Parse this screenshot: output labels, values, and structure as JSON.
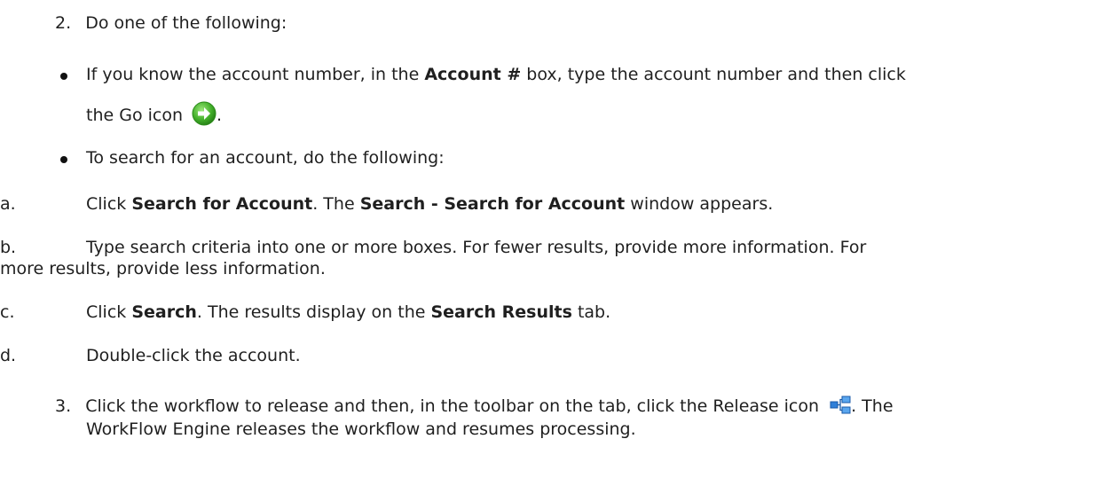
{
  "step2": {
    "number": "2.",
    "text": "Do one of the following:"
  },
  "bullet1": {
    "t1": "If you know the account number, in the ",
    "b1": "Account #",
    "t2": " box, type the account number and then click",
    "t3": "the Go icon ",
    "t4": ".",
    "icon": "go-arrow-icon"
  },
  "bullet2": {
    "text": "To search for an account, do the following:"
  },
  "suba": {
    "label": "a.",
    "t1": "Click ",
    "b1": "Search for Account",
    "t2": ". The ",
    "b2": "Search - Search for Account",
    "t3": " window appears."
  },
  "subb": {
    "label": "b.",
    "t1": "Type search criteria into one or more boxes. For fewer results, provide more information. For",
    "t2": "more results, provide less information."
  },
  "subc": {
    "label": "c.",
    "t1": "Click ",
    "b1": "Search",
    "t2": ". The results display on the ",
    "b2": "Search Results",
    "t3": " tab."
  },
  "subd": {
    "label": "d.",
    "text": "Double-click the account."
  },
  "step3": {
    "number": "3.",
    "t1": "Click the workflow to release and then, in the toolbar on the tab, click the Release icon ",
    "t2": ". The",
    "t3": "WorkFlow Engine releases the workflow and resumes processing.",
    "icon": "release-workflow-icon"
  },
  "colors": {
    "go_icon": "#43b02a",
    "release_icon": "#2f7fd8",
    "text": "#1f1f1f"
  }
}
